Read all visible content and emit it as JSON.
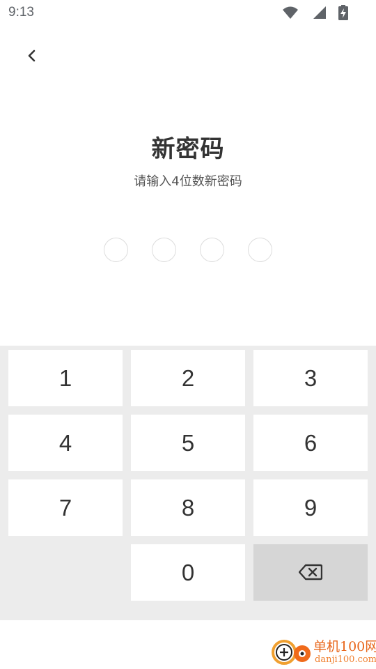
{
  "status_bar": {
    "time": "9:13",
    "icons": [
      "wifi-icon",
      "signal-icon",
      "battery-charging-icon"
    ]
  },
  "header": {
    "back_icon": "chevron-left-icon"
  },
  "title": "新密码",
  "subtitle": "请输入4位数新密码",
  "pin": {
    "length": 4,
    "filled": 0
  },
  "keypad": {
    "keys": [
      "1",
      "2",
      "3",
      "4",
      "5",
      "6",
      "7",
      "8",
      "9",
      "0"
    ],
    "delete_icon": "backspace-icon"
  },
  "watermark": {
    "name": "单机100网",
    "url": "danji100.com"
  },
  "colors": {
    "keypad_bg": "#ececec",
    "key_bg": "#ffffff",
    "delete_key_bg": "#d6d6d6",
    "text": "#333333",
    "watermark": "#e8661a"
  }
}
